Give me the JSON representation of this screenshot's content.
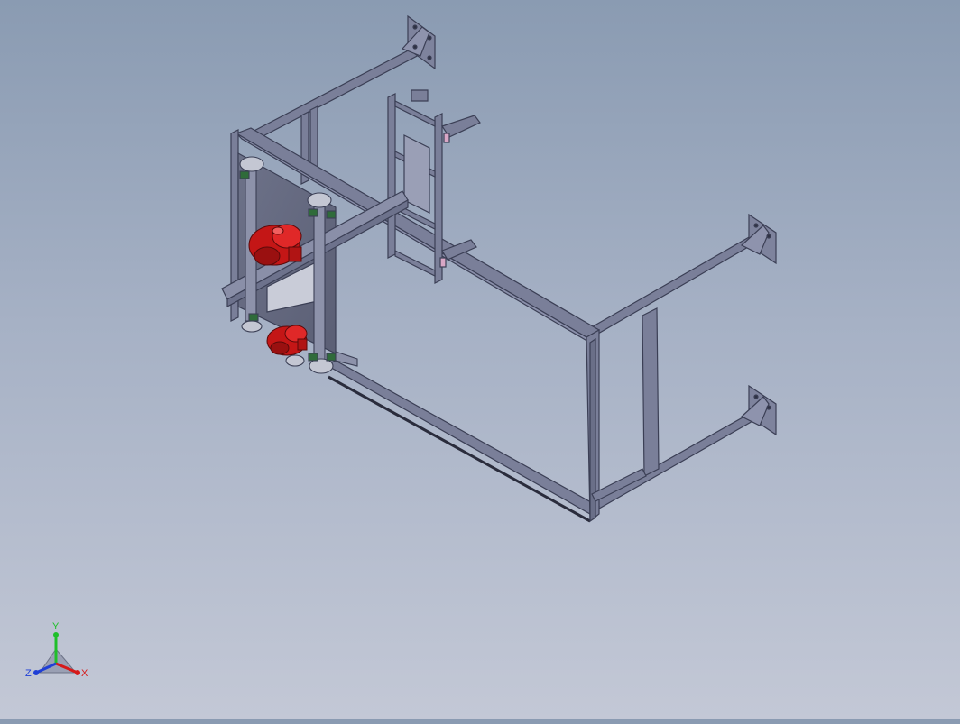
{
  "viewport": {
    "background_top": "#8a9bb2",
    "background_bottom": "#c3c8d6"
  },
  "model": {
    "frame_color": "#747a96",
    "frame_edge_color": "#3b3f55",
    "motor_color": "#c41616",
    "bearing_color": "#2f6b3a",
    "accent_pink": "#d8a7c6"
  },
  "triad": {
    "y_label": "Y",
    "x_label": "X",
    "z_label": "Z",
    "y_color": "#1fbf2a",
    "x_color": "#d61a1a",
    "z_color": "#1f3fd6"
  }
}
